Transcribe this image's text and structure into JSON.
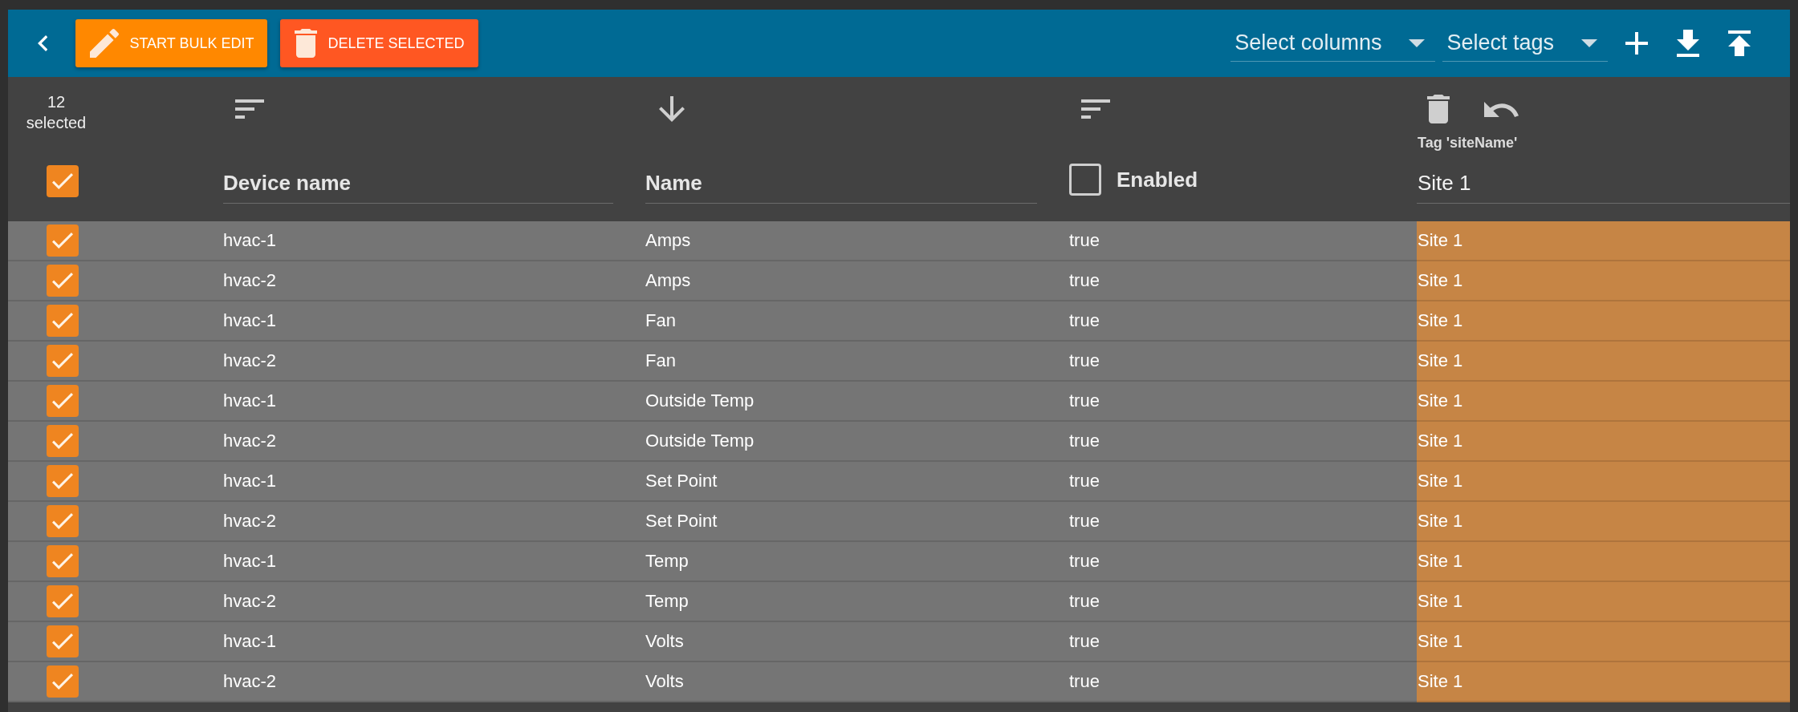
{
  "toolbar": {
    "buttons": [
      {
        "kind": "edit",
        "label": "START BULK EDIT"
      },
      {
        "kind": "delete",
        "label": "DELETE SELECTED"
      }
    ],
    "dropdowns": [
      {
        "placeholder": "Select columns"
      },
      {
        "placeholder": "Select tags"
      }
    ]
  },
  "selection": {
    "summary": "12 selected",
    "all_checked": true
  },
  "columns": [
    {
      "kind": "text",
      "label": "Device name",
      "sorted": false
    },
    {
      "kind": "text",
      "label": "Name",
      "sorted": true
    },
    {
      "kind": "boolean",
      "label": "Enabled",
      "sorted": false,
      "checked": false
    },
    {
      "kind": "tag",
      "label": "Tag 'siteName'",
      "value": "Site 1"
    }
  ],
  "rows": [
    {
      "selected": true,
      "cells": [
        "hvac-1",
        "Amps",
        "true",
        "Site 1"
      ]
    },
    {
      "selected": true,
      "cells": [
        "hvac-2",
        "Amps",
        "true",
        "Site 1"
      ]
    },
    {
      "selected": true,
      "cells": [
        "hvac-1",
        "Fan",
        "true",
        "Site 1"
      ]
    },
    {
      "selected": true,
      "cells": [
        "hvac-2",
        "Fan",
        "true",
        "Site 1"
      ]
    },
    {
      "selected": true,
      "cells": [
        "hvac-1",
        "Outside Temp",
        "true",
        "Site 1"
      ]
    },
    {
      "selected": true,
      "cells": [
        "hvac-2",
        "Outside Temp",
        "true",
        "Site 1"
      ]
    },
    {
      "selected": true,
      "cells": [
        "hvac-1",
        "Set Point",
        "true",
        "Site 1"
      ]
    },
    {
      "selected": true,
      "cells": [
        "hvac-2",
        "Set Point",
        "true",
        "Site 1"
      ]
    },
    {
      "selected": true,
      "cells": [
        "hvac-1",
        "Temp",
        "true",
        "Site 1"
      ]
    },
    {
      "selected": true,
      "cells": [
        "hvac-2",
        "Temp",
        "true",
        "Site 1"
      ]
    },
    {
      "selected": true,
      "cells": [
        "hvac-1",
        "Volts",
        "true",
        "Site 1"
      ]
    },
    {
      "selected": true,
      "cells": [
        "hvac-2",
        "Volts",
        "true",
        "Site 1"
      ]
    }
  ]
}
